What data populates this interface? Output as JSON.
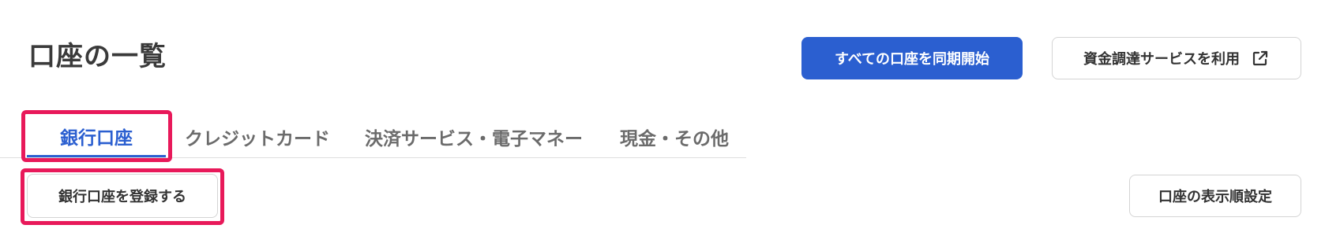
{
  "header": {
    "title": "口座の一覧",
    "sync_all_label": "すべての口座を同期開始",
    "funding_label": "資金調達サービスを利用",
    "funding_icon": "external-link-icon"
  },
  "tabs": [
    {
      "label": "銀行口座",
      "active": true
    },
    {
      "label": "クレジットカード",
      "active": false
    },
    {
      "label": "決済サービス・電子マネー",
      "active": false
    },
    {
      "label": "現金・その他",
      "active": false
    }
  ],
  "actions": {
    "register_label": "銀行口座を登録する",
    "display_order_label": "口座の表示順設定"
  },
  "colors": {
    "accent": "#2b5fd0",
    "highlight": "#e8195a",
    "tab_inactive": "#6b6b6b"
  }
}
